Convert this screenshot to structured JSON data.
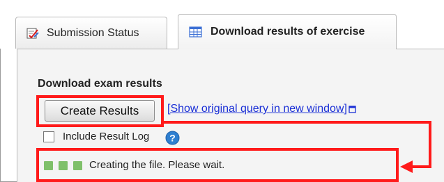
{
  "tabs": [
    {
      "label": "Submission Status",
      "icon": "edit-check-icon",
      "active": false
    },
    {
      "label": "Download results of exercise",
      "icon": "spreadsheet-icon",
      "active": true
    }
  ],
  "content": {
    "section_title": "Download exam results",
    "create_button_label": "Create Results",
    "query_link_text": "[Show original query in new window]",
    "include_log_label": "Include Result Log",
    "include_log_checked": false,
    "progress_message": "Creating the file. Please wait."
  },
  "colors": {
    "annotation": "#ff1a1a",
    "progress_dot": "#7fc06a",
    "link": "#1a2fd6",
    "help_icon": "#2f7fd0"
  }
}
